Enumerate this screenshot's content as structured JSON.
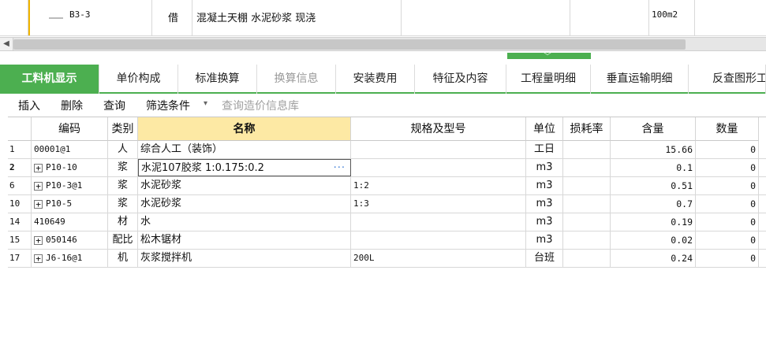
{
  "top_row": {
    "code": "B3-3",
    "category": "借",
    "name": "混凝土天棚 水泥砂浆 现浇",
    "unit": "100m2"
  },
  "scroll": {
    "left_arrow": "◀"
  },
  "tabs": [
    {
      "label": "工料机显示",
      "state": "active"
    },
    {
      "label": "单价构成",
      "state": "normal"
    },
    {
      "label": "标准换算",
      "state": "normal"
    },
    {
      "label": "换算信息",
      "state": "disabled"
    },
    {
      "label": "安装费用",
      "state": "normal"
    },
    {
      "label": "特征及内容",
      "state": "normal"
    },
    {
      "label": "工程量明细",
      "state": "normal"
    },
    {
      "label": "垂直运输明细",
      "state": "normal"
    },
    {
      "label": "反查图形工",
      "state": "normal"
    }
  ],
  "toolbar": {
    "insert": "插入",
    "delete": "删除",
    "query": "查询",
    "filter": "筛选条件",
    "filter_caret": "▾",
    "price_query": "查询造价信息库"
  },
  "grid": {
    "headers": {
      "code": "编码",
      "category": "类别",
      "name": "名称",
      "spec": "规格及型号",
      "unit": "单位",
      "loss": "损耗率",
      "content": "含量",
      "qty": "数量"
    },
    "rows": [
      {
        "idx": "1",
        "expand": "",
        "code": "00001@1",
        "category": "人",
        "name": "综合人工（装饰）",
        "spec": "",
        "unit": "工日",
        "loss": "",
        "content": "15.66",
        "qty": "0"
      },
      {
        "idx": "2",
        "expand": "+",
        "code": "P10-10",
        "category": "浆",
        "name": "水泥107胶浆 1:0.175:0.2",
        "spec": "",
        "unit": "m3",
        "loss": "",
        "content": "0.1",
        "qty": "0",
        "current": true
      },
      {
        "idx": "6",
        "expand": "+",
        "code": "P10-3@1",
        "category": "浆",
        "name": "水泥砂浆",
        "spec": "1:2",
        "unit": "m3",
        "loss": "",
        "content": "0.51",
        "qty": "0"
      },
      {
        "idx": "10",
        "expand": "+",
        "code": "P10-5",
        "category": "浆",
        "name": "水泥砂浆",
        "spec": "1:3",
        "unit": "m3",
        "loss": "",
        "content": "0.7",
        "qty": "0"
      },
      {
        "idx": "14",
        "expand": "",
        "code": "410649",
        "category": "材",
        "name": "水",
        "spec": "",
        "unit": "m3",
        "loss": "",
        "content": "0.19",
        "qty": "0"
      },
      {
        "idx": "15",
        "expand": "+",
        "code": "050146",
        "category": "配比",
        "name": "松木锯材",
        "spec": "",
        "unit": "m3",
        "loss": "",
        "content": "0.02",
        "qty": "0"
      },
      {
        "idx": "17",
        "expand": "+",
        "code": "J6-16@1",
        "category": "机",
        "name": "灰浆搅拌机",
        "spec": "200L",
        "unit": "台班",
        "loss": "",
        "content": "0.24",
        "qty": "0"
      }
    ],
    "edit_dots": "···"
  },
  "colors": {
    "accent": "#4caf50",
    "name_header": "#fde9a4",
    "selection_marker": "#f0b400"
  }
}
